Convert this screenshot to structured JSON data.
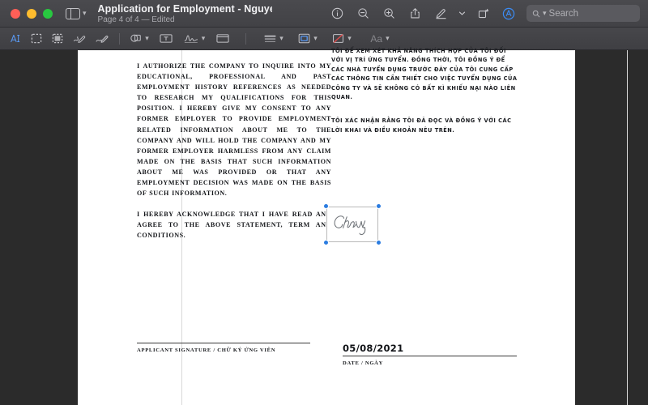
{
  "window": {
    "title": "Application for Employment - Nguyen Le…",
    "subtitle": "Page 4 of 4 — Edited",
    "traffic_lights": [
      "close-red",
      "minimize-yellow",
      "zoom-green"
    ],
    "colors": {
      "titlebar": "#454549",
      "accent_blue": "#2b7ce0",
      "toolbar_icon": "#c9c9ce",
      "red": "#ff5f57",
      "yellow": "#febc2e",
      "green": "#28c840",
      "page": "#ffffff",
      "canvas": "#2b2b2b"
    }
  },
  "toolbar": {
    "sidebar_toggle": "Sidebar",
    "items": [
      {
        "name": "info-icon",
        "label": "Info"
      },
      {
        "name": "zoom-out-icon",
        "label": "Zoom Out"
      },
      {
        "name": "zoom-in-icon",
        "label": "Zoom In"
      },
      {
        "name": "share-icon",
        "label": "Share"
      },
      {
        "name": "markup-pen-icon",
        "label": "Show Markup Toolbar"
      },
      {
        "name": "chevron-down-icon",
        "label": "More"
      },
      {
        "name": "rotate-icon",
        "label": "Rotate"
      },
      {
        "name": "annotate-icon",
        "label": "Annotate"
      }
    ],
    "search": {
      "placeholder": "Search",
      "value": ""
    }
  },
  "markup_toolbar": {
    "items": [
      {
        "name": "text-selection-tool",
        "label": "Text Selection",
        "selected": true
      },
      {
        "name": "rectangular-selection-tool",
        "label": "Rectangular Selection",
        "selected": false
      },
      {
        "name": "instant-alpha-tool",
        "label": "Instant Alpha",
        "selected": false
      },
      {
        "name": "sketch-tool",
        "label": "Sketch",
        "selected": false
      },
      {
        "name": "draw-tool",
        "label": "Draw",
        "selected": false
      },
      {
        "name": "shapes-tool",
        "label": "Shapes",
        "selected": false
      },
      {
        "name": "text-tool",
        "label": "Text",
        "selected": false
      },
      {
        "name": "sign-tool",
        "label": "Sign",
        "selected": false
      },
      {
        "name": "note-tool",
        "label": "Note",
        "selected": false
      },
      {
        "name": "shape-style-tool",
        "label": "Shape Style",
        "selected": false
      },
      {
        "name": "border-color-tool",
        "label": "Border Color",
        "selected": false
      },
      {
        "name": "fill-color-tool",
        "label": "Fill Color",
        "selected": false
      },
      {
        "name": "font-style-tool",
        "label": "Aa",
        "selected": false,
        "disabled": true
      }
    ],
    "font_label": "Aa"
  },
  "document": {
    "english": {
      "paragraph_1": "I AUTHORIZE THE COMPANY TO INQUIRE INTO MY EDUCATIONAL, PROFESSIONAL AND PAST EMPLOYMENT HISTORY REFERENCES AS NEEDED TO RESEARCH MY QUALIFICATIONS FOR THIS POSITION. I HEREBY GIVE MY CONSENT TO ANY FORMER EMPLOYER TO PROVIDE EMPLOYMENT RELATED INFORMATION ABOUT ME TO THE COMPANY AND WILL HOLD THE COMPANY AND MY FORMER EMPLOYER HARMLESS FROM ANY CLAIM MADE ON THE BASIS THAT SUCH INFORMATION ABOUT ME WAS PROVIDED OR THAT ANY EMPLOYMENT DECISION WAS MADE ON THE BASIS OF SUCH INFORMATION.",
      "paragraph_2": "I HEREBY ACKNOWLEDGE THAT I HAVE READ AND AGREE TO THE ABOVE STATEMENT, TERM AND CONDITIONS."
    },
    "vietnamese": {
      "paragraph_1": "TÔI ĐỂ XEM XÉT KHẢ NĂNG THÍCH HỢP CỦA TÔI ĐỐI VỚI VỊ TRÍ ỨNG TUYỂN. ĐỒNG THỜI, TÔI ĐỒNG Ý ĐỂ CÁC NHÀ TUYỂN DỤNG TRƯỚC ĐÂY CỦA TÔI CUNG CẤP CÁC THÔNG TIN CẦN THIẾT CHO VIỆC TUYỂN DỤNG CỦA CÔNG TY VÀ SẼ KHÔNG CÓ BẤT KÌ KHIẾU NẠI NÀO LIÊN QUAN.",
      "paragraph_2": "TÔI XÁC NHẬN RẰNG TÔI ĐÃ ĐỌC VÀ ĐỒNG Ý VỚI CÁC LỜI KHAI VÀ ĐIỀU KHOẢN NÊU TRÊN."
    },
    "signature_annotation": {
      "name": "signature-annotation",
      "text": "Chuky",
      "selected": true,
      "handle_color": "#2b7ce0"
    },
    "footer": {
      "applicant_signature_label": "APPLICANT SIGNATURE / CHỮ KÝ ỨNG VIÊN",
      "date_label": "DATE / NGÀY",
      "date_value": "05/08/2021"
    }
  }
}
